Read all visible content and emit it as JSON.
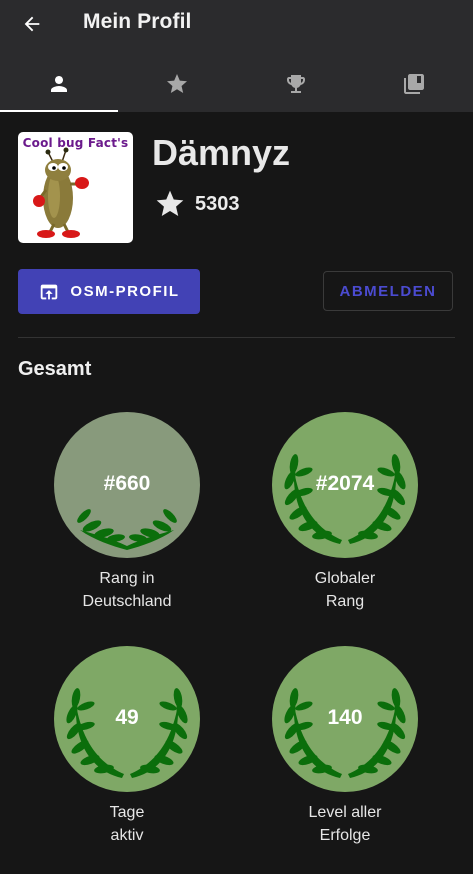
{
  "header": {
    "title": "Mein Profil",
    "back_icon": "arrow-left-icon"
  },
  "tabs": [
    {
      "icon": "person-icon",
      "active": true
    },
    {
      "icon": "star-icon",
      "active": false
    },
    {
      "icon": "trophy-icon",
      "active": false
    },
    {
      "icon": "library-books-icon",
      "active": false
    }
  ],
  "profile": {
    "avatar_text": "Cool bug Fact's",
    "username": "Dämnyz",
    "score": "5303"
  },
  "buttons": {
    "osm_label": "OSM-PROFIL",
    "logout_label": "ABMELDEN"
  },
  "section": {
    "title": "Gesamt"
  },
  "stats": [
    {
      "value": "#660",
      "label_line1": "Rang in",
      "label_line2": "Deutschland",
      "circle_color": "#889a7c",
      "wreath": "bottom"
    },
    {
      "value": "#2074",
      "label_line1": "Globaler",
      "label_line2": "Rang",
      "circle_color": "#7fa866",
      "wreath": "full"
    },
    {
      "value": "49",
      "label_line1": "Tage",
      "label_line2": "aktiv",
      "circle_color": "#7fa866",
      "wreath": "full"
    },
    {
      "value": "140",
      "label_line1": "Level aller",
      "label_line2": "Erfolge",
      "circle_color": "#7fa866",
      "wreath": "full"
    }
  ],
  "colors": {
    "accent": "#4242b5",
    "wreath": "#0b6e0b"
  }
}
